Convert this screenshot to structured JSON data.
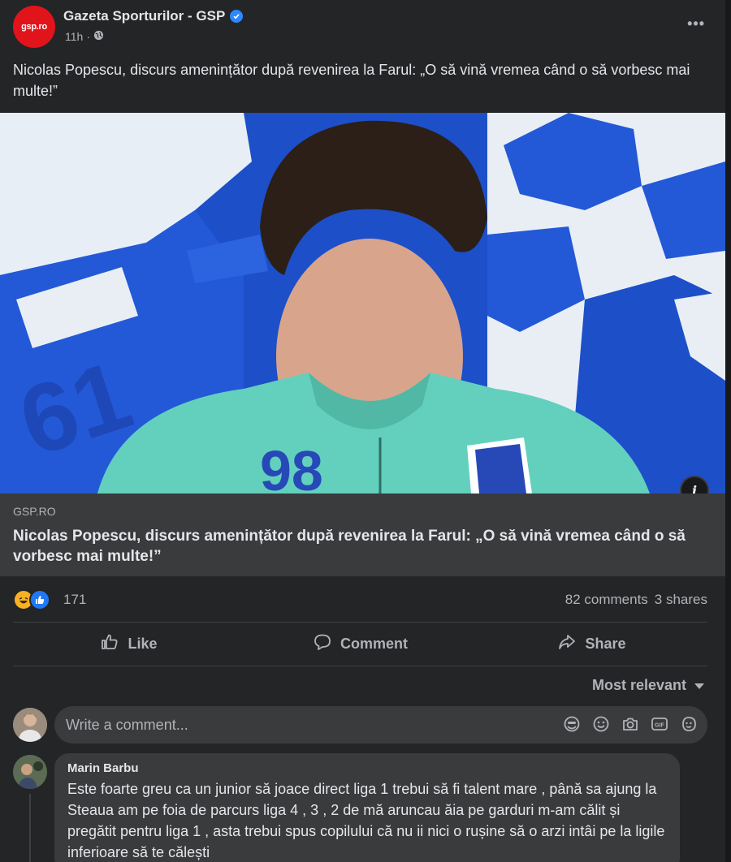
{
  "post": {
    "page_name": "Gazeta Sporturilor - GSP",
    "avatar_text": "gsp.ro",
    "timestamp": "11h",
    "text": "Nicolas Popescu, discurs amenințător după revenirea la Farul: „O să vină vremea când o să vorbesc mai multe!”",
    "image_jersey_number": "98"
  },
  "link_preview": {
    "domain": "GSP.RO",
    "title": "Nicolas Popescu, discurs amenințător după revenirea la Farul: „O să vină vremea când o să vorbesc mai multe!”"
  },
  "stats": {
    "reaction_count": "171",
    "comments": "82 comments",
    "shares": "3 shares"
  },
  "actions": {
    "like": "Like",
    "comment": "Comment",
    "share": "Share"
  },
  "comments_section": {
    "sort_label": "Most relevant",
    "composer_placeholder": "Write a comment...",
    "items": [
      {
        "author": "Marin Barbu",
        "text": "Este foarte greu ca un junior să joace direct liga 1 trebui să fi talent mare , până sa ajung la Steaua am pe foia de parcurs liga 4 , 3 , 2 de mă aruncau ăia pe garduri m-am călit și pregătit pentru liga 1 , asta trebui spus copilului că nu ii nici o rușine să o arzi intâi pe la ligile inferioare să te călești"
      }
    ]
  },
  "colors": {
    "background": "#242526",
    "surface": "#3a3b3c",
    "text_primary": "#e4e6eb",
    "text_secondary": "#b0b3b8",
    "brand_red": "#e1141b",
    "accent_blue": "#2d88ff"
  },
  "icons": [
    "verified-icon",
    "globe-icon",
    "more-icon",
    "info-icon",
    "haha-reaction-icon",
    "like-reaction-icon",
    "like-icon",
    "comment-icon",
    "share-icon",
    "chevron-down-icon",
    "sticker-icon",
    "emoji-icon",
    "camera-icon",
    "gif-icon",
    "avatar-sticker-icon"
  ]
}
